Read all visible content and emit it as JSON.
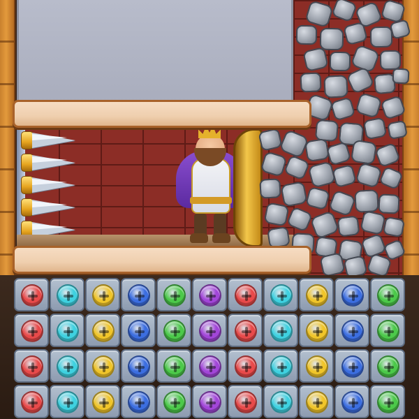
{
  "level": {
    "room_state": "king-standing-with-shield",
    "hazards": [
      "spikes-left",
      "falling-rocks-right"
    ],
    "spike_count": 5,
    "pins": [
      {
        "name": "top-pin",
        "state": "inserted"
      },
      {
        "name": "bottom-pin",
        "state": "inserted"
      }
    ]
  },
  "characters": {
    "king": {
      "name": "king",
      "holding": "golden-shield"
    }
  },
  "screw_grid": {
    "rows": 4,
    "columns": 11,
    "column_colors": [
      "red",
      "cyan",
      "yellow",
      "blue",
      "green",
      "purple",
      "red",
      "cyan",
      "yellow",
      "blue",
      "green"
    ],
    "palette": {
      "red": "#e84a4a",
      "cyan": "#3fd1e0",
      "yellow": "#f0c52a",
      "blue": "#3c6ee0",
      "green": "#4cc94a",
      "purple": "#a246d8"
    }
  },
  "colors": {
    "wood": "#e39a3c",
    "brick": "#8c2d26",
    "pin": "#efcfae",
    "stone": "#9ea4ae"
  }
}
